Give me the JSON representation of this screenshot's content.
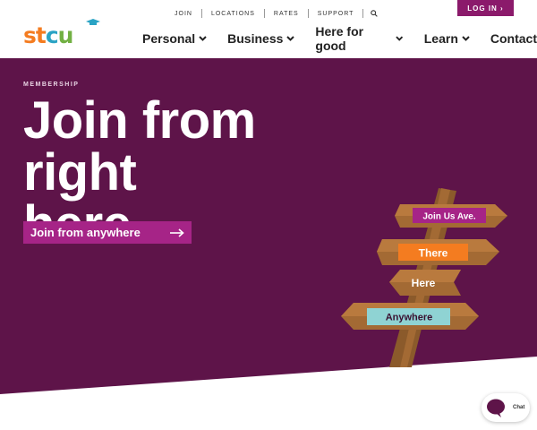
{
  "brand": {
    "logo_text": "stcu",
    "logo_colors": {
      "s": "#f47c20",
      "t": "#f47c20",
      "c": "#2aa3c4",
      "u": "#72b043"
    }
  },
  "utility_nav": {
    "items": [
      "JOIN",
      "LOCATIONS",
      "RATES",
      "SUPPORT"
    ],
    "search_icon": "search-icon"
  },
  "login": {
    "label": "LOG IN ›"
  },
  "main_nav": {
    "items": [
      {
        "label": "Personal",
        "has_dropdown": true
      },
      {
        "label": "Business",
        "has_dropdown": true
      },
      {
        "label": "Here for good",
        "has_dropdown": true
      },
      {
        "label": "Learn",
        "has_dropdown": true
      },
      {
        "label": "Contact",
        "has_dropdown": false
      }
    ]
  },
  "hero": {
    "eyebrow": "MEMBERSHIP",
    "headline_line1": "Join from right",
    "headline_line2": "here.",
    "cta_label": "Join from anywhere",
    "cta_icon": "arrow-right-icon",
    "background_color": "#5e1449",
    "signs": [
      "Join Us Ave.",
      "There",
      "Here",
      "Anywhere"
    ]
  },
  "chat": {
    "label": "Chat",
    "icon": "chat-bubble-icon"
  },
  "colors": {
    "accent": "#8b1a6b",
    "cta": "#a62487",
    "hero_bg": "#5e1449"
  }
}
